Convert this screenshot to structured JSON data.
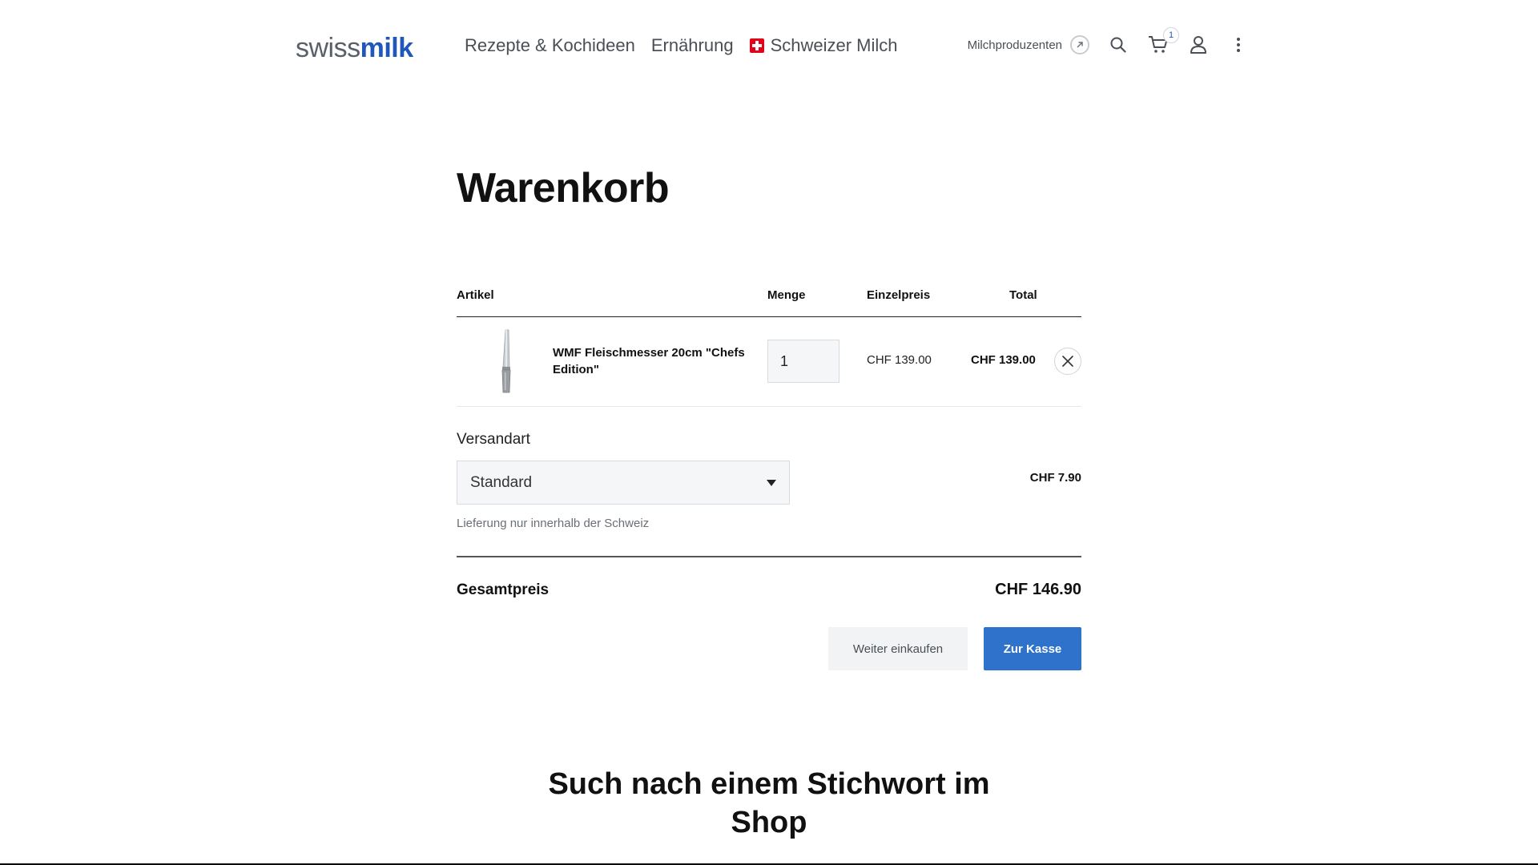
{
  "header": {
    "logo": {
      "swiss": "swiss",
      "milk": "milk"
    },
    "nav": [
      {
        "label": "Rezepte & Kochideen"
      },
      {
        "label": "Ernährung"
      },
      {
        "label": "Schweizer Milch",
        "icon": "swiss-flag-icon"
      }
    ],
    "producers_link": "Milchproduzenten",
    "cart_count": "1",
    "icons": [
      "external-link-icon",
      "search-icon",
      "cart-icon",
      "user-icon",
      "more-vertical-icon"
    ]
  },
  "page": {
    "title": "Warenkorb"
  },
  "table": {
    "columns": {
      "article": "Artikel",
      "quantity": "Menge",
      "unit_price": "Einzelpreis",
      "total": "Total"
    },
    "rows": [
      {
        "name": "WMF Fleischmesser 20cm \"Chefs Edition\"",
        "quantity": "1",
        "unit_price": "CHF 139.00",
        "total": "CHF 139.00"
      }
    ]
  },
  "shipping": {
    "label": "Versandart",
    "selected": "Standard",
    "price": "CHF 7.90",
    "note": "Lieferung nur innerhalb der Schweiz"
  },
  "summary": {
    "label": "Gesamtpreis",
    "value": "CHF 146.90"
  },
  "actions": {
    "continue": "Weiter einkaufen",
    "checkout": "Zur Kasse"
  },
  "search_section": {
    "heading": "Such nach einem Stichwort im Shop"
  },
  "colors": {
    "brand_blue": "#1f58b8",
    "button_blue": "#2f72cc",
    "flag_red": "#e3001b"
  }
}
